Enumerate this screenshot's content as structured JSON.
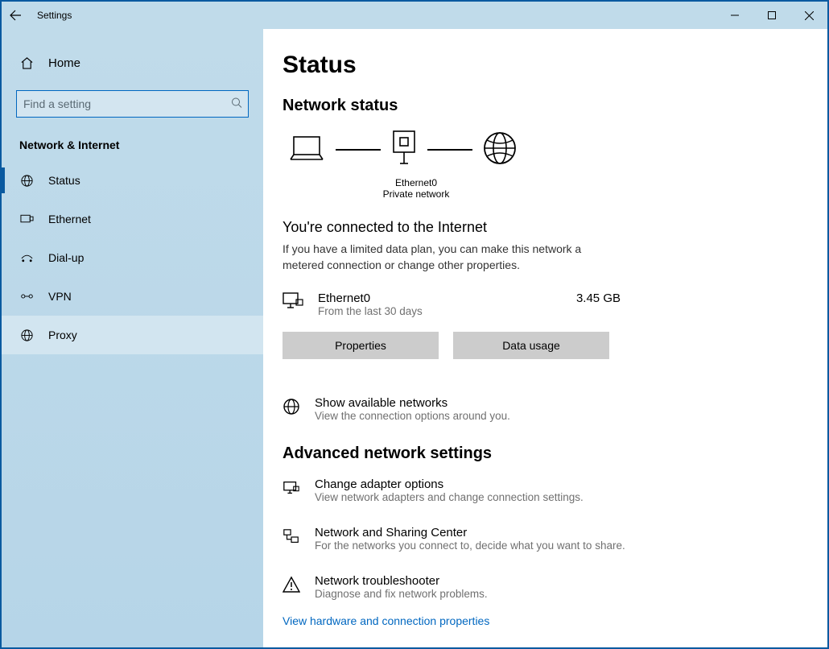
{
  "window": {
    "title": "Settings"
  },
  "sidebar": {
    "home": "Home",
    "search_placeholder": "Find a setting",
    "category": "Network & Internet",
    "items": [
      {
        "label": "Status"
      },
      {
        "label": "Ethernet"
      },
      {
        "label": "Dial-up"
      },
      {
        "label": "VPN"
      },
      {
        "label": "Proxy"
      }
    ]
  },
  "main": {
    "title": "Status",
    "section1": "Network status",
    "diagram": {
      "adapter": "Ethernet0",
      "network_type": "Private network"
    },
    "connected_heading": "You're connected to the Internet",
    "connected_desc": "If you have a limited data plan, you can make this network a metered connection or change other properties.",
    "usage": {
      "adapter": "Ethernet0",
      "period": "From the last 30 days",
      "amount": "3.45 GB"
    },
    "buttons": {
      "properties": "Properties",
      "data_usage": "Data usage"
    },
    "show_networks": {
      "title": "Show available networks",
      "sub": "View the connection options around you."
    },
    "section2": "Advanced network settings",
    "adv": [
      {
        "title": "Change adapter options",
        "sub": "View network adapters and change connection settings."
      },
      {
        "title": "Network and Sharing Center",
        "sub": "For the networks you connect to, decide what you want to share."
      },
      {
        "title": "Network troubleshooter",
        "sub": "Diagnose and fix network problems."
      }
    ],
    "footer_link": "View hardware and connection properties"
  }
}
